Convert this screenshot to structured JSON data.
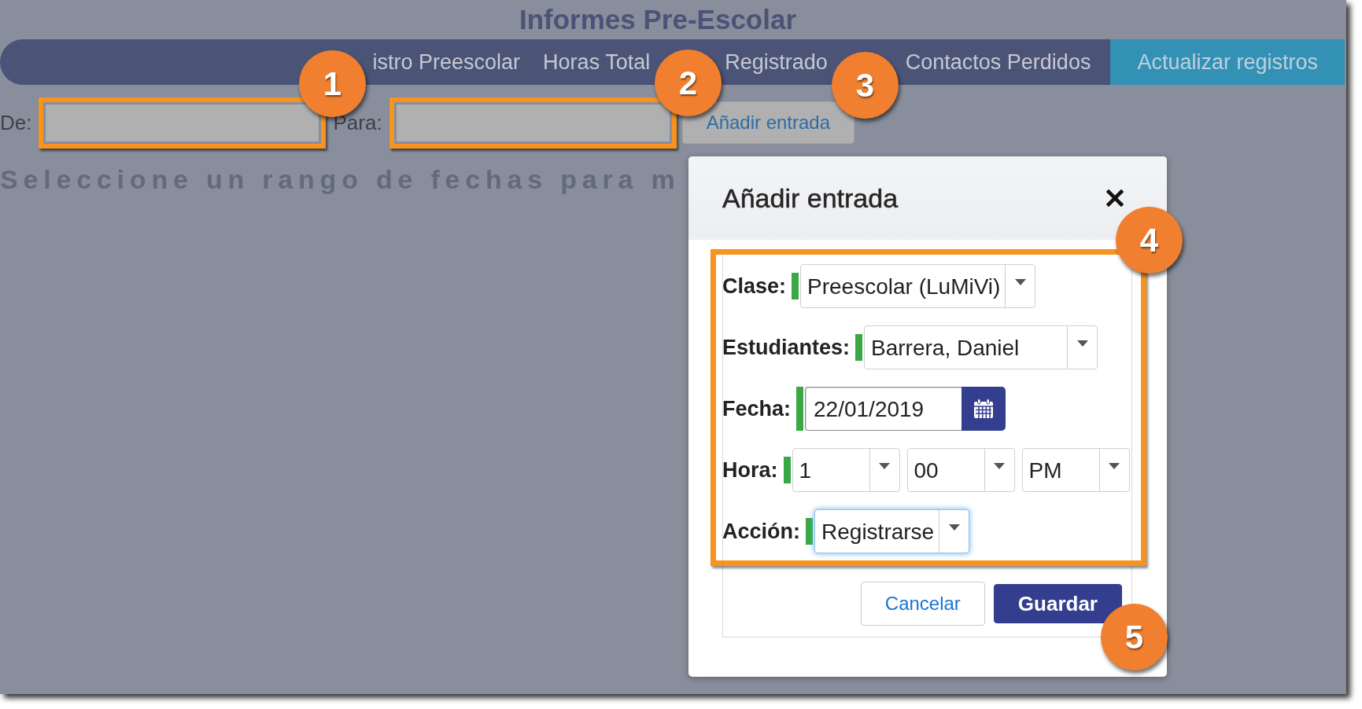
{
  "page": {
    "title": "Informes Pre-Escolar"
  },
  "nav": {
    "tabs": [
      {
        "label": "istro Preescolar",
        "selected": false
      },
      {
        "label": "Horas Total",
        "selected": false
      },
      {
        "label": "Registrado",
        "selected": false
      },
      {
        "label": "Contactos Perdidos",
        "selected": false
      },
      {
        "label": "Actualizar registros",
        "selected": true
      }
    ]
  },
  "filters": {
    "fields": [
      {
        "label": "De:",
        "highlighted": true
      },
      {
        "label": "Para:",
        "highlighted": true
      }
    ],
    "add_button": "Añadir entrada"
  },
  "message": "Seleccione un rango de fechas para m",
  "dialog": {
    "title": "Añadir entrada",
    "form_highlighted": true,
    "fields": [
      {
        "kind": "select",
        "label": "Clase:",
        "required": true,
        "focused": false,
        "value": "Preescolar (LuMiVi)"
      },
      {
        "kind": "select",
        "label": "Estudiantes:",
        "required": true,
        "focused": false,
        "value": "Barrera, Daniel"
      },
      {
        "kind": "date",
        "label": "Fecha:",
        "required": true,
        "value": "22/01/2019"
      },
      {
        "kind": "time",
        "label": "Hora:",
        "required": true,
        "parts": [
          {
            "value": "1"
          },
          {
            "value": "00"
          },
          {
            "value": "PM"
          }
        ]
      },
      {
        "kind": "select",
        "label": "Acción:",
        "required": true,
        "focused": true,
        "value": "Registrarse"
      }
    ],
    "buttons": [
      {
        "label": "Cancelar",
        "kind": "secondary"
      },
      {
        "label": "Guardar",
        "kind": "primary"
      }
    ]
  },
  "callouts": [
    "1",
    "2",
    "3",
    "4",
    "5"
  ]
}
